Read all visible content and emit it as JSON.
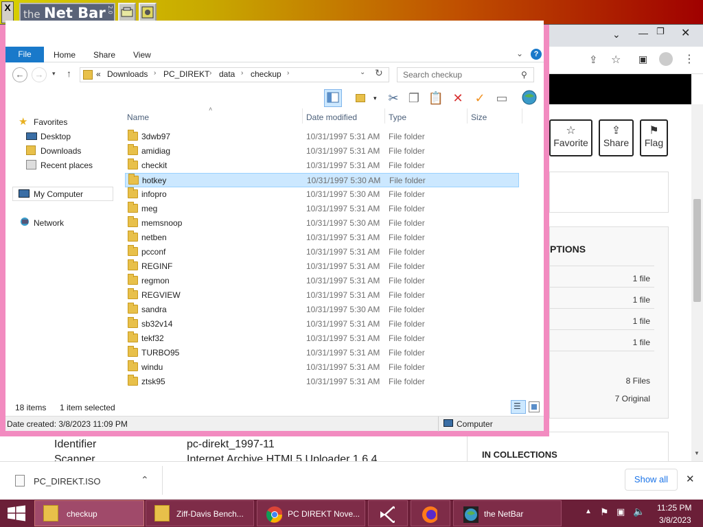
{
  "netbar": {
    "logo_the": "the",
    "logo_name": "Net Bar",
    "logo_ver": "2.0",
    "close": "X"
  },
  "browser": {
    "actions": [
      {
        "icon": "star-icon",
        "label": "Favorite"
      },
      {
        "icon": "share-icon",
        "label": "Share"
      },
      {
        "icon": "flag-icon",
        "label": "Flag"
      }
    ],
    "section_title": "PTIONS",
    "files": [
      "1 file",
      "1 file",
      "1 file",
      "1 file"
    ],
    "summary": [
      "8 Files",
      "7 Original"
    ],
    "collections_title": "IN COLLECTIONS",
    "meta": [
      {
        "key": "Identifier",
        "value": "pc-direkt_1997-11"
      },
      {
        "key": "Scanner",
        "value": "Internet Archive HTML5 Uploader 1.6.4"
      }
    ]
  },
  "explorer": {
    "title": "checkup",
    "ribbon": {
      "file": "File",
      "tabs": [
        "Home",
        "Share",
        "View"
      ]
    },
    "breadcrumb": [
      "«",
      "Downloads",
      "PC_DIREKT",
      "data",
      "checkup"
    ],
    "search_placeholder": "Search checkup",
    "nav": {
      "favorites": "Favorites",
      "favorites_items": [
        "Desktop",
        "Downloads",
        "Recent places"
      ],
      "computer": "My Computer",
      "network": "Network"
    },
    "columns": [
      "Name",
      "Date modified",
      "Type",
      "Size"
    ],
    "rows": [
      {
        "name": "3dwb97",
        "date": "10/31/1997 5:31 AM",
        "type": "File folder"
      },
      {
        "name": "amidiag",
        "date": "10/31/1997 5:31 AM",
        "type": "File folder"
      },
      {
        "name": "checkit",
        "date": "10/31/1997 5:31 AM",
        "type": "File folder"
      },
      {
        "name": "hotkey",
        "date": "10/31/1997 5:30 AM",
        "type": "File folder",
        "selected": true
      },
      {
        "name": "infopro",
        "date": "10/31/1997 5:30 AM",
        "type": "File folder"
      },
      {
        "name": "meg",
        "date": "10/31/1997 5:31 AM",
        "type": "File folder"
      },
      {
        "name": "memsnoop",
        "date": "10/31/1997 5:30 AM",
        "type": "File folder"
      },
      {
        "name": "netben",
        "date": "10/31/1997 5:31 AM",
        "type": "File folder"
      },
      {
        "name": "pcconf",
        "date": "10/31/1997 5:31 AM",
        "type": "File folder"
      },
      {
        "name": "REGINF",
        "date": "10/31/1997 5:31 AM",
        "type": "File folder"
      },
      {
        "name": "regmon",
        "date": "10/31/1997 5:31 AM",
        "type": "File folder"
      },
      {
        "name": "REGVIEW",
        "date": "10/31/1997 5:31 AM",
        "type": "File folder"
      },
      {
        "name": "sandra",
        "date": "10/31/1997 5:30 AM",
        "type": "File folder"
      },
      {
        "name": "sb32v14",
        "date": "10/31/1997 5:31 AM",
        "type": "File folder"
      },
      {
        "name": "tekf32",
        "date": "10/31/1997 5:31 AM",
        "type": "File folder"
      },
      {
        "name": "TURBO95",
        "date": "10/31/1997 5:31 AM",
        "type": "File folder"
      },
      {
        "name": "windu",
        "date": "10/31/1997 5:31 AM",
        "type": "File folder"
      },
      {
        "name": "ztsk95",
        "date": "10/31/1997 5:31 AM",
        "type": "File folder"
      }
    ],
    "status": {
      "count": "18 items",
      "selected": "1 item selected",
      "date_created": "Date created: 3/8/2023 11:09 PM",
      "location": "Computer"
    }
  },
  "download": {
    "file": "PC_DIREKT.ISO",
    "show_all": "Show all"
  },
  "taskbar": {
    "tasks": [
      "checkup",
      "Ziff-Davis Bench...",
      "PC DIREKT Nove...",
      "",
      "",
      "the NetBar"
    ],
    "time": "11:25 PM",
    "date": "3/8/2023"
  },
  "colors": {
    "explorer_frame": "#f28bc0",
    "taskbar": "#6b1f38",
    "file_tab": "#1979ca",
    "selection": "#cce8ff"
  }
}
